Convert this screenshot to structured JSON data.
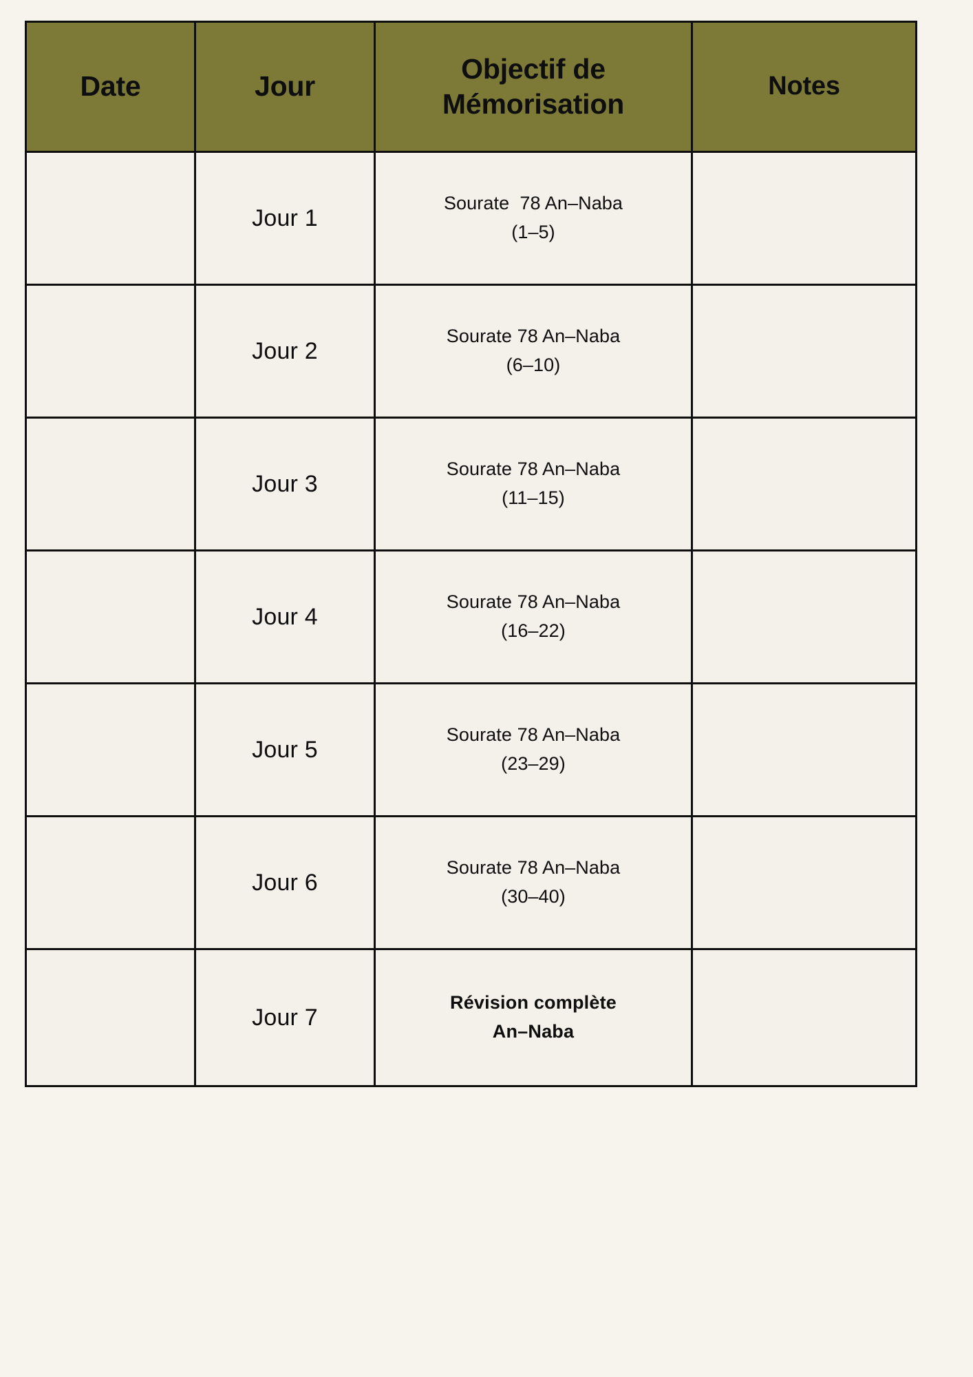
{
  "theme": {
    "page_background": "#F7F4EE",
    "header_background": "#7D7937",
    "cell_background": "#F4F1EA",
    "border_color": "#0E0E0E",
    "text_color": "#0E0E0E"
  },
  "table": {
    "columns": [
      {
        "key": "date",
        "label": "Date"
      },
      {
        "key": "jour",
        "label": "Jour"
      },
      {
        "key": "objectif",
        "label_line1": "Objectif de",
        "label_line2": "Mémorisation"
      },
      {
        "key": "notes",
        "label": "Notes"
      }
    ],
    "rows": [
      {
        "date": "",
        "jour": "Jour 1",
        "objectif_line1": "Sourate  78 An–Naba",
        "objectif_line2": "(1–5)",
        "bold": false,
        "notes": ""
      },
      {
        "date": "",
        "jour": "Jour 2",
        "objectif_line1": "Sourate 78 An–Naba",
        "objectif_line2": "(6–10)",
        "bold": false,
        "notes": ""
      },
      {
        "date": "",
        "jour": "Jour 3",
        "objectif_line1": "Sourate 78 An–Naba",
        "objectif_line2": "(11–15)",
        "bold": false,
        "notes": ""
      },
      {
        "date": "",
        "jour": "Jour 4",
        "objectif_line1": "Sourate 78 An–Naba",
        "objectif_line2": "(16–22)",
        "bold": false,
        "notes": ""
      },
      {
        "date": "",
        "jour": "Jour 5",
        "objectif_line1": "Sourate 78 An–Naba",
        "objectif_line2": "(23–29)",
        "bold": false,
        "notes": ""
      },
      {
        "date": "",
        "jour": "Jour 6",
        "objectif_line1": "Sourate 78 An–Naba",
        "objectif_line2": "(30–40)",
        "bold": false,
        "notes": ""
      },
      {
        "date": "",
        "jour": "Jour 7",
        "objectif_line1": "Révision complète",
        "objectif_line2": "An–Naba",
        "bold": true,
        "notes": ""
      }
    ]
  }
}
